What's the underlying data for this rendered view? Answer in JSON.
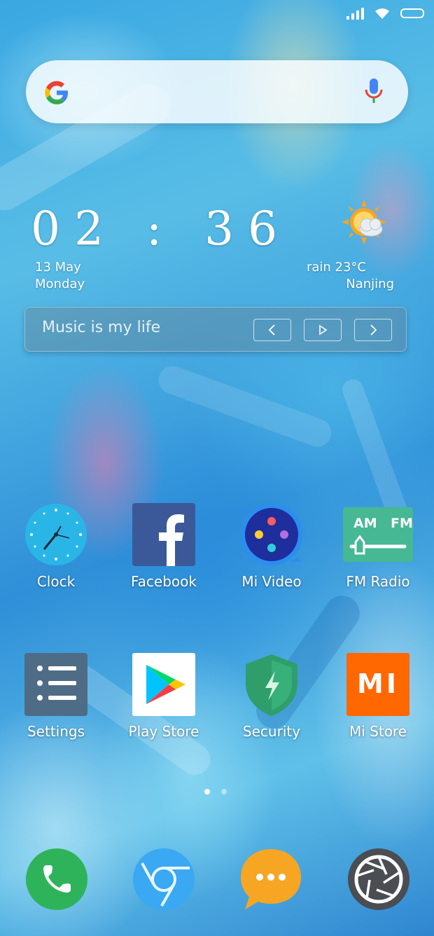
{
  "clock": {
    "time": "02 : 36",
    "date": "13 May",
    "weekday": "Monday"
  },
  "weather": {
    "condition": "rain 23°C",
    "city": "Nanjing"
  },
  "music": {
    "title": "Music is my life"
  },
  "apps_row1": [
    {
      "label": "Clock",
      "icon": "clock-icon"
    },
    {
      "label": "Facebook",
      "icon": "facebook-icon"
    },
    {
      "label": "Mi Video",
      "icon": "mi-video-icon"
    },
    {
      "label": "FM Radio",
      "icon": "fm-radio-icon"
    }
  ],
  "apps_row2": [
    {
      "label": "Settings",
      "icon": "settings-icon"
    },
    {
      "label": "Play Store",
      "icon": "play-store-icon"
    },
    {
      "label": "Security",
      "icon": "security-icon"
    },
    {
      "label": "Mi Store",
      "icon": "mi-store-icon"
    }
  ],
  "fm_radio": {
    "am": "AM",
    "fm": "FM"
  },
  "mi_store": {
    "logo": "MI"
  },
  "dock": [
    {
      "icon": "phone-icon"
    },
    {
      "icon": "browser-icon"
    },
    {
      "icon": "messaging-icon"
    },
    {
      "icon": "camera-icon"
    }
  ],
  "colors": {
    "facebook": "#3b5998",
    "mi_store": "#ff6700",
    "security": "#2f9e6b",
    "phone": "#2fb35a",
    "messaging": "#f6a623"
  }
}
